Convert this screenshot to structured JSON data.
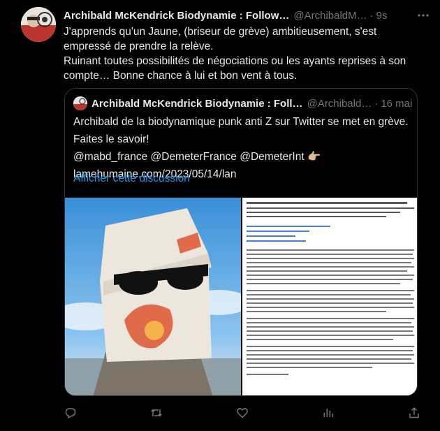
{
  "tweet": {
    "author_name": "Archibald McKendrick Biodynamie : Follow…",
    "author_handle": "@ArchibaldM…",
    "separator": "·",
    "time": "9s",
    "text_lines": [
      "J'apprends qu'un Jaune, (briseur de grève) ambitieusement, s'est empressé de prendre la relève.",
      "Ruinant toutes possibilités de négociations ou les ayants reprises à son compte… Bonne chance à lui et bon vent à tous."
    ]
  },
  "quoted": {
    "author_name": "Archibald McKendrick Biodynamie : Foll…",
    "author_handle": "@Archibald…",
    "separator": "·",
    "time": "16 mai",
    "line1": "Archibald de la biodynamique punk anti Z sur Twitter se met en grève.",
    "line2": "Faites le savoir!",
    "mentions": "@mabd_france @DemeterFrance @DemeterInt",
    "pointing_emoji": "👉🏼",
    "url": "lamehumaine.com/2023/05/14/lan",
    "show_thread": "Afficher cette discussion"
  },
  "icons": [
    "more-icon",
    "reply-icon",
    "retweet-icon",
    "like-icon",
    "views-icon",
    "share-icon"
  ],
  "colors": {
    "background": "#000000",
    "text": "#e7e9ea",
    "muted": "#71767b",
    "link": "#1d9bf0",
    "border": "#2f3336"
  }
}
